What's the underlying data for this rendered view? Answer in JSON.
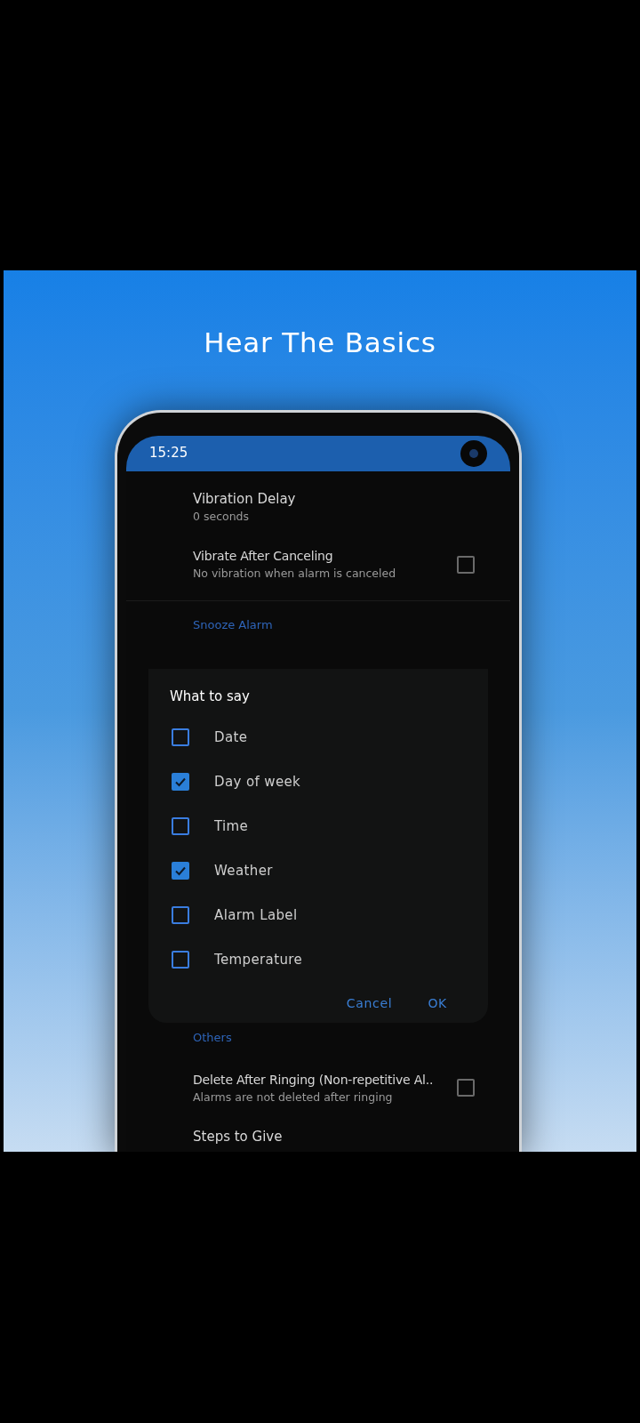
{
  "promo_title": "Hear The Basics",
  "status_bar": {
    "time": "15:25"
  },
  "settings": [
    {
      "kind": "item",
      "title": "Vibration Delay",
      "subtitle": "0 seconds"
    },
    {
      "kind": "check",
      "title": "Vibrate After Canceling",
      "subtitle": "No vibration when alarm is canceled",
      "checked": false
    },
    {
      "kind": "header",
      "title": "Snooze Alarm"
    }
  ],
  "settings_below": [
    {
      "kind": "header",
      "title": "Others"
    },
    {
      "kind": "check",
      "title": "Delete After Ringing (Non-repetitive Al..",
      "subtitle": "Alarms are not deleted after ringing",
      "checked": false
    },
    {
      "kind": "item",
      "title": "Steps to Give"
    }
  ],
  "dialog": {
    "title": "What to say",
    "options": [
      {
        "label": "Date",
        "checked": false
      },
      {
        "label": "Day of week",
        "checked": true
      },
      {
        "label": "Time",
        "checked": false
      },
      {
        "label": "Weather",
        "checked": true
      },
      {
        "label": "Alarm Label",
        "checked": false
      },
      {
        "label": "Temperature",
        "checked": false
      }
    ],
    "buttons": [
      "Cancel",
      "OK"
    ]
  }
}
